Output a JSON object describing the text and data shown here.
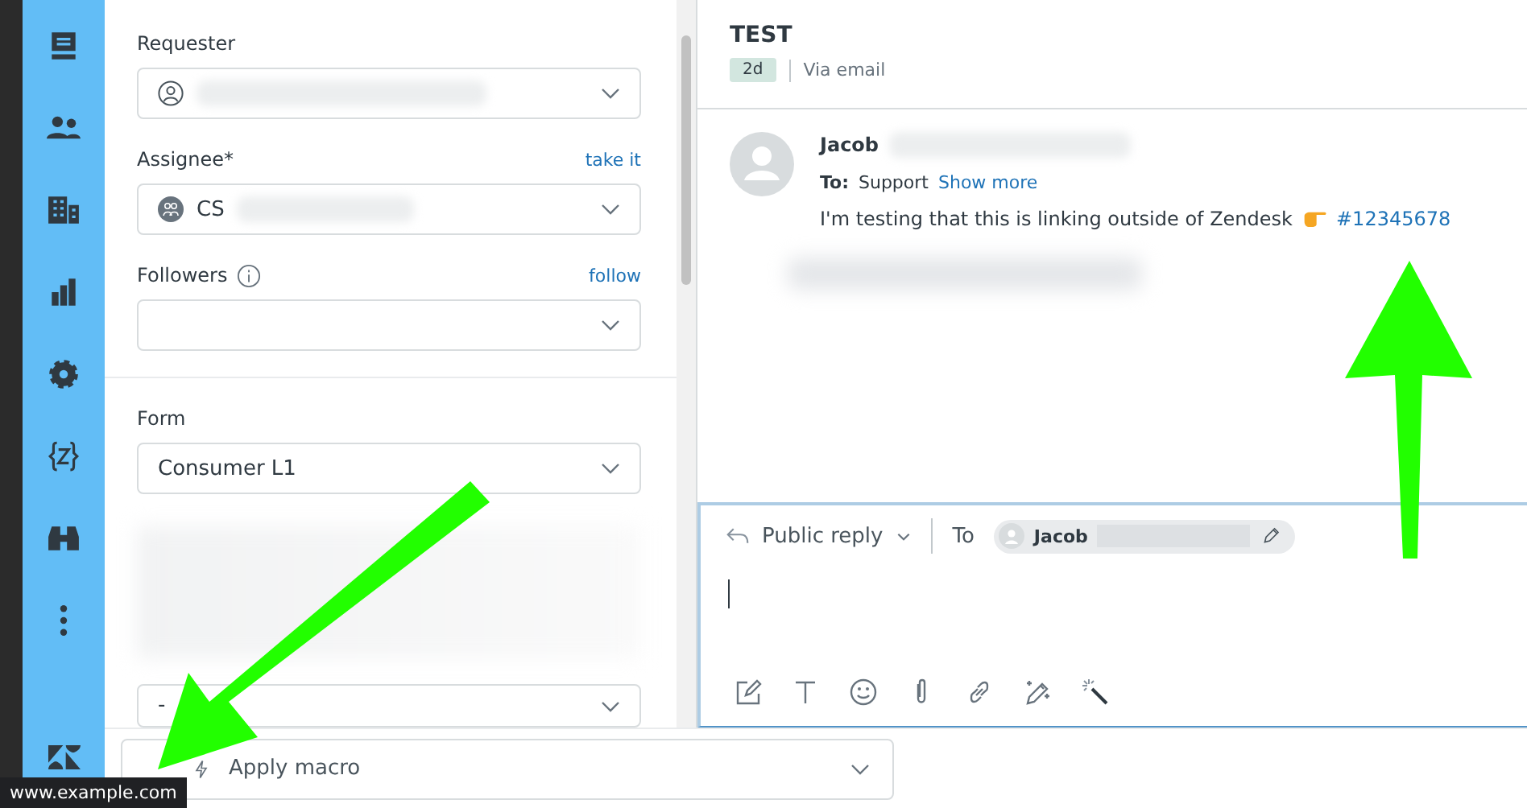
{
  "properties": {
    "fields": [
      {
        "kind": "requester",
        "label": "Requester"
      },
      {
        "kind": "assignee",
        "label": "Assignee*",
        "action": "take it",
        "value": "CS"
      },
      {
        "kind": "followers",
        "label": "Followers",
        "action": "follow"
      }
    ],
    "form": {
      "label": "Form",
      "value": "Consumer L1"
    },
    "extra_field": {
      "value": "-"
    }
  },
  "ticket": {
    "title": "TEST",
    "age": "2d",
    "channel": "Via email"
  },
  "message": {
    "author": "Jacob",
    "to_label": "To:",
    "to": "Support",
    "show_more": "Show more",
    "body": "I'm testing that this is linking outside of Zendesk",
    "link": "#12345678"
  },
  "composer": {
    "reply_type": "Public reply",
    "to_label": "To",
    "recipient": "Jacob"
  },
  "macro": {
    "placeholder": "Apply macro"
  },
  "status_url": "www.example.com"
}
